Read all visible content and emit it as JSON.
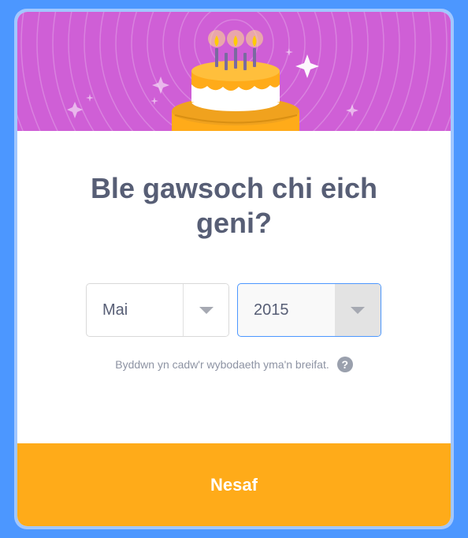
{
  "dialog": {
    "title": "Ble gawsoch chi eich geni?",
    "month_select": {
      "value": "Mai"
    },
    "year_select": {
      "value": "2015"
    },
    "privacy_note": "Byddwn yn cadw'r wybodaeth yma'n breifat.",
    "help_icon_glyph": "?",
    "next_button_label": "Nesaf"
  },
  "colors": {
    "page_background": "#4c97ff",
    "banner": "#cf5fd6",
    "cake_body": "#ffab19",
    "button": "#ffab19",
    "title_text": "#575e75",
    "help_icon": "#9aa0ad"
  },
  "icons": {
    "banner": "birthday-cake-illustration",
    "help": "question-mark-icon",
    "dropdown": "chevron-down-icon"
  }
}
